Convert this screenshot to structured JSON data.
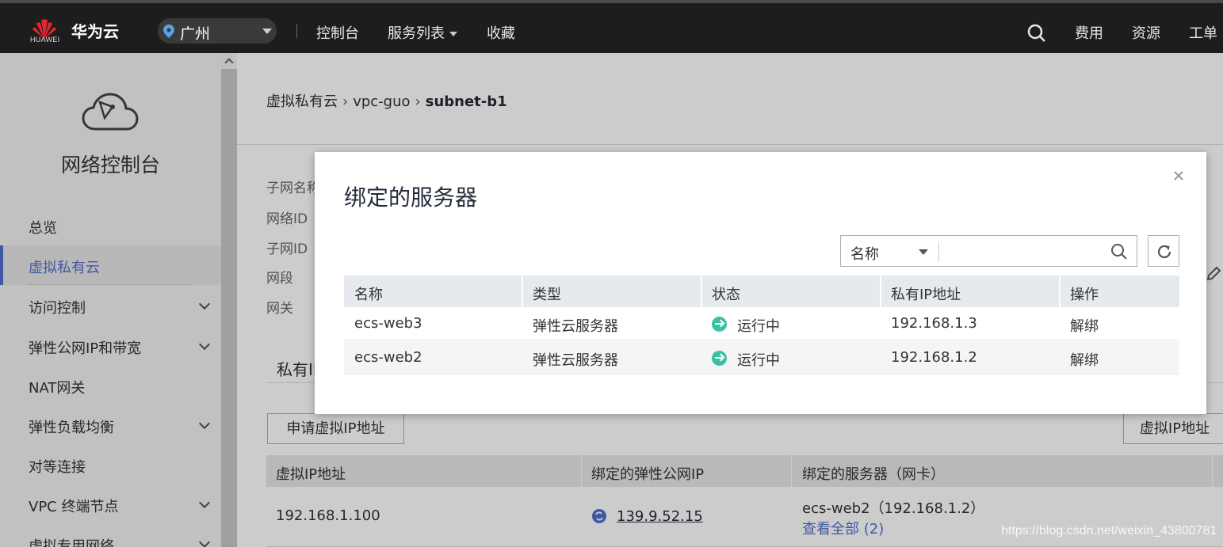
{
  "topbar": {
    "logo_text": "HUAWEI",
    "brand": "华为云",
    "region": "广州",
    "nav": [
      "控制台",
      "服务列表",
      "收藏"
    ],
    "right": [
      "费用",
      "资源",
      "工单"
    ]
  },
  "sidebar": {
    "title": "网络控制台",
    "items": [
      {
        "label": "总览"
      },
      {
        "label": "虚拟私有云"
      },
      {
        "label": "访问控制"
      },
      {
        "label": "弹性公网IP和带宽"
      },
      {
        "label": "NAT网关"
      },
      {
        "label": "弹性负载均衡"
      },
      {
        "label": "对等连接"
      },
      {
        "label": "VPC 终端节点"
      },
      {
        "label": "虚拟专用网络"
      }
    ]
  },
  "breadcrumb": {
    "items": [
      "虚拟私有云",
      "vpc-guo"
    ],
    "current": "subnet-b1"
  },
  "fields": [
    "子网名称",
    "网络ID",
    "子网ID",
    "网段",
    "网关"
  ],
  "tab": "私有IP",
  "buttons": {
    "apply_vip": "申请虚拟IP地址",
    "vip_filter": "虚拟IP地址"
  },
  "vip_table": {
    "headers": [
      "虚拟IP地址",
      "绑定的弹性公网IP",
      "绑定的服务器（网卡）"
    ],
    "row": {
      "vip": "192.168.1.100",
      "eip": "139.9.52.15",
      "server": "ecs-web2（192.168.1.2）",
      "view_all": "查看全部 (2)"
    }
  },
  "dialog": {
    "title": "绑定的服务器",
    "filter_label": "名称",
    "search_placeholder": "",
    "headers": [
      "名称",
      "类型",
      "状态",
      "私有IP地址",
      "操作"
    ],
    "rows": [
      {
        "name": "ecs-web3",
        "type": "弹性云服务器",
        "status": "运行中",
        "ip": "192.168.1.3",
        "action": "解绑"
      },
      {
        "name": "ecs-web2",
        "type": "弹性云服务器",
        "status": "运行中",
        "ip": "192.168.1.2",
        "action": "解绑"
      }
    ]
  },
  "watermark": "https://blog.csdn.net/weixin_43800781",
  "colors": {
    "accent": "#526ecc",
    "status_running": "#3ac1a2",
    "topbar": "#1d1d1d"
  }
}
